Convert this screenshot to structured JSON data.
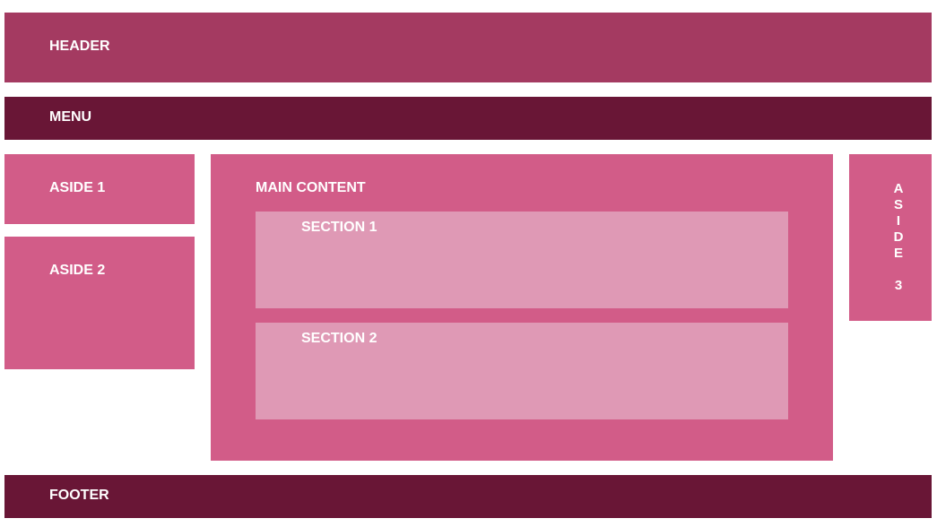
{
  "header": {
    "label": "HEADER"
  },
  "menu": {
    "label": "MENU"
  },
  "aside1": {
    "label": "ASIDE 1"
  },
  "aside2": {
    "label": "ASIDE 2"
  },
  "main": {
    "label": "MAIN CONTENT",
    "sections": [
      {
        "label": "SECTION 1"
      },
      {
        "label": "SECTION 2"
      }
    ]
  },
  "aside3": {
    "label": "ASIDE 3"
  },
  "footer": {
    "label": "FOOTER"
  },
  "colors": {
    "header": "#a43a61",
    "menu_footer": "#691636",
    "panel": "#d25c88",
    "section": "#df99b5",
    "text": "#ffffff"
  }
}
